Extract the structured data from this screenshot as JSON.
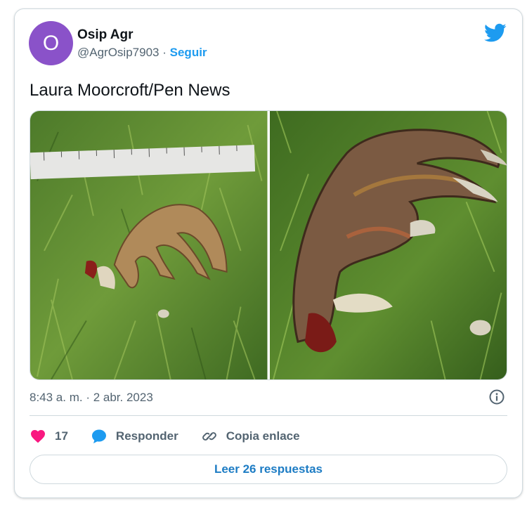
{
  "author": {
    "avatar_letter": "O",
    "name": "Osip Agr",
    "handle": "@AgrOsip7903",
    "separator": "·",
    "follow_label": "Seguir"
  },
  "tweet": {
    "text": "Laura Moorcroft/Pen News",
    "timestamp": "8:43 a. m. · 2 abr. 2023"
  },
  "actions": {
    "like_count": "17",
    "reply_label": "Responder",
    "copy_link_label": "Copia enlace"
  },
  "read_replies_label": "Leer 26 respuestas",
  "colors": {
    "accent": "#1d9bf0",
    "like": "#f91880",
    "avatar": "#8a52c9"
  },
  "icons": [
    "twitter-bird-icon",
    "info-icon",
    "heart-icon",
    "reply-bubble-icon",
    "link-icon"
  ]
}
